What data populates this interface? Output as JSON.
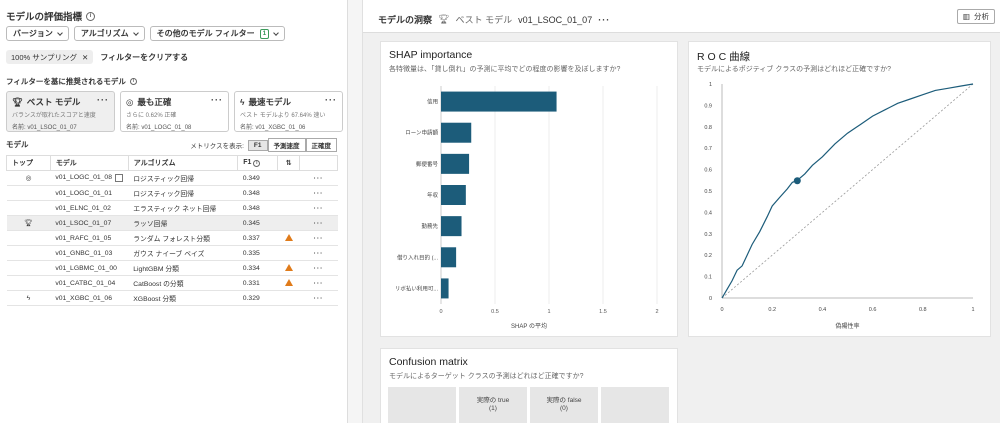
{
  "left": {
    "title": "モデルの評価指標",
    "filters": {
      "version": "バージョン",
      "algorithm": "アルゴリズム",
      "other": "その他のモデル フィルター",
      "other_count": "1"
    },
    "chip": "100% サンプリング",
    "clear": "フィルターをクリアする",
    "recommended_title": "フィルターを基に推奨されるモデル",
    "cards": [
      {
        "title": "ベスト モデル",
        "sub": "バランスが取れたスコアと速度",
        "name": "名前: v01_LSOC_01_07"
      },
      {
        "title": "最も正確",
        "sub": "さらに 0.62% 正確",
        "name": "名前: v01_LOGC_01_08"
      },
      {
        "title": "最速モデル",
        "sub": "ベスト モデルより 67.64% 速い",
        "name": "名前: v01_XGBC_01_06"
      }
    ],
    "models_label": "モデル",
    "metrics_label": "メトリクスを表示:",
    "metric_tabs": [
      "F1",
      "予測速度",
      "正確度"
    ],
    "table": {
      "headers": [
        "トップ",
        "モデル",
        "アルゴリズム",
        "F1"
      ],
      "rows": [
        {
          "top": "target",
          "model": "v01_LOGC_01_08",
          "algo": "ロジスティック回帰",
          "f1": "0.349",
          "warn": false,
          "grid": true
        },
        {
          "top": "",
          "model": "v01_LOGC_01_01",
          "algo": "ロジスティック回帰",
          "f1": "0.348",
          "warn": false,
          "grid": false
        },
        {
          "top": "",
          "model": "v01_ELNC_01_02",
          "algo": "エラスティック ネット回帰",
          "f1": "0.348",
          "warn": false,
          "grid": false
        },
        {
          "top": "trophy",
          "model": "v01_LSOC_01_07",
          "algo": "ラッソ回帰",
          "f1": "0.345",
          "warn": false,
          "grid": false,
          "selected": true
        },
        {
          "top": "",
          "model": "v01_RAFC_01_05",
          "algo": "ランダム フォレスト分類",
          "f1": "0.337",
          "warn": true,
          "grid": false
        },
        {
          "top": "",
          "model": "v01_GNBC_01_03",
          "algo": "ガウス ナイーブ ベイズ",
          "f1": "0.335",
          "warn": false,
          "grid": false
        },
        {
          "top": "",
          "model": "v01_LGBMC_01_00",
          "algo": "LightGBM 分類",
          "f1": "0.334",
          "warn": true,
          "grid": false
        },
        {
          "top": "",
          "model": "v01_CATBC_01_04",
          "algo": "CatBoost の分類",
          "f1": "0.331",
          "warn": true,
          "grid": false
        },
        {
          "top": "bolt",
          "model": "v01_XGBC_01_06",
          "algo": "XGBoost 分類",
          "f1": "0.329",
          "warn": false,
          "grid": false
        }
      ]
    }
  },
  "right": {
    "header": {
      "title": "モデルの洞察",
      "sub": "ベスト モデル",
      "model": "v01_LSOC_01_07",
      "analyze": "分析"
    },
    "shap": {
      "title": "SHAP importance",
      "subtitle": "各特徴量は、「貸し倒れ」の予測に平均でどの程度の影響を及ぼしますか?"
    },
    "roc": {
      "title": "R O C 曲線",
      "subtitle": "モデルによるポジティブ クラスの予測はどれほど正確ですか?"
    },
    "cm": {
      "title": "Confusion matrix",
      "subtitle": "モデルによるターゲット クラスの予測はどれほど正確ですか?",
      "cells": [
        "",
        "実際の true\n(1)",
        "実際の false\n(0)",
        ""
      ]
    }
  },
  "chart_data": [
    {
      "type": "bar",
      "orientation": "horizontal",
      "categories": [
        "信用",
        "ローン申請額",
        "郵便番号",
        "年収",
        "勤務先",
        "借り入れ目的 (...",
        "リボ払い利用可..."
      ],
      "values": [
        1.07,
        0.28,
        0.26,
        0.23,
        0.19,
        0.14,
        0.07
      ],
      "xlabel": "SHAP の平均",
      "xlim": [
        0,
        2
      ],
      "xticks": [
        "0",
        "0.5",
        "1",
        "1.5",
        "2"
      ],
      "color": "#1c5c7a"
    },
    {
      "type": "line",
      "series": [
        {
          "x": [
            0,
            0.02,
            0.04,
            0.06,
            0.08,
            0.1,
            0.12,
            0.15,
            0.18,
            0.2,
            0.23,
            0.26,
            0.28,
            0.3,
            0.33,
            0.36,
            0.4,
            0.45,
            0.5,
            0.55,
            0.6,
            0.65,
            0.7,
            0.75,
            0.8,
            0.85,
            0.9,
            0.95,
            1.0
          ],
          "y": [
            0,
            0.04,
            0.08,
            0.13,
            0.15,
            0.2,
            0.25,
            0.31,
            0.38,
            0.43,
            0.47,
            0.51,
            0.54,
            0.55,
            0.58,
            0.62,
            0.66,
            0.72,
            0.77,
            0.81,
            0.85,
            0.88,
            0.91,
            0.93,
            0.95,
            0.97,
            0.98,
            0.99,
            1.0
          ]
        }
      ],
      "point": {
        "x": 0.3,
        "y": 0.548
      },
      "xlabel": "偽陽性率",
      "xlim": [
        0,
        1
      ],
      "ylim": [
        0,
        1
      ],
      "xticks": [
        "0",
        "0.2",
        "0.4",
        "0.6",
        "0.8",
        "1"
      ],
      "yticks": [
        "0",
        "0.1",
        "0.2",
        "0.3",
        "0.4",
        "0.5",
        "0.6",
        "0.7",
        "0.8",
        "0.9",
        "1"
      ],
      "color": "#1c5c7a"
    }
  ]
}
